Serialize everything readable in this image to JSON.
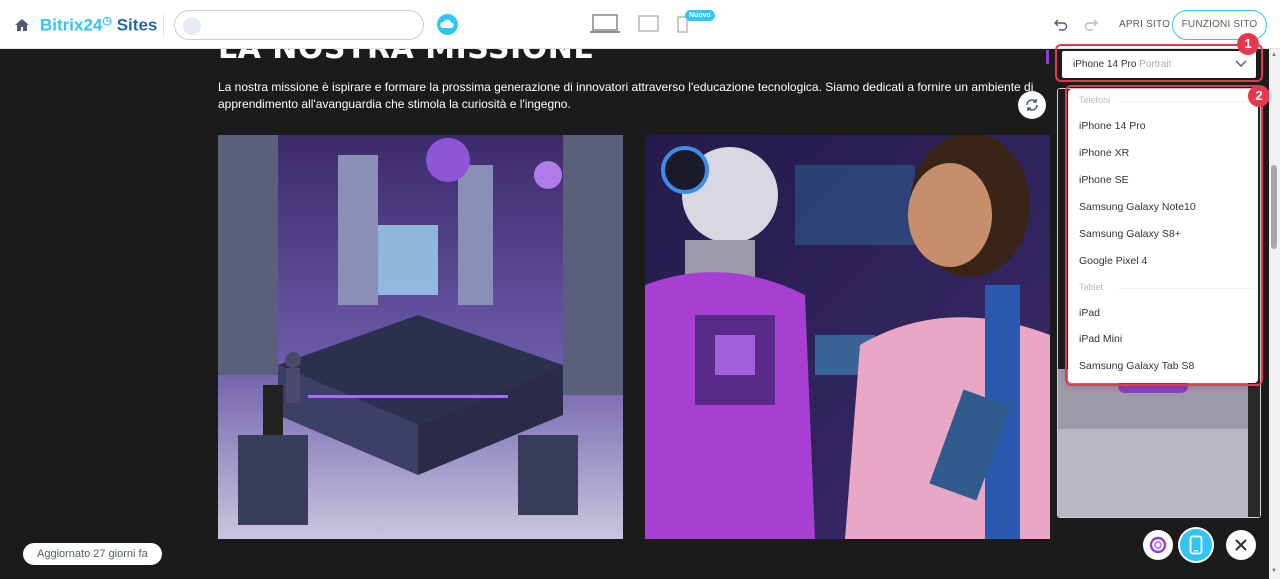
{
  "header": {
    "logo_b24": "Bitrix24",
    "logo_sites": "Sites",
    "new_badge": "Nuovo",
    "open_site": "APRI SITO",
    "site_features": "FUNZIONI SITO"
  },
  "page": {
    "title": "LA NOSTRA MISSIONE",
    "text": "La nostra missione è ispirare e formare la prossima generazione di innovatori attraverso l'educazione tecnologica. Siamo dedicati a fornire un ambiente di apprendimento all'avanguardia che stimola la curiosità e l'ingegno."
  },
  "device_select": {
    "selected_device": "iPhone 14 Pro",
    "orientation": "Portrait",
    "groups": [
      {
        "label": "Telefoni",
        "items": [
          "iPhone 14 Pro",
          "iPhone XR",
          "iPhone SE",
          "Samsung Galaxy Note10",
          "Samsung Galaxy S8+",
          "Google Pixel 4"
        ]
      },
      {
        "label": "Tablet",
        "items": [
          "iPad",
          "iPad Mini",
          "Samsung Galaxy Tab S8"
        ]
      }
    ]
  },
  "annotations": {
    "marker1": "1",
    "marker2": "2"
  },
  "footer": {
    "updated": "Aggiornato 27 giorni fa"
  },
  "colors": {
    "accent": "#2fc6f6",
    "highlight": "#e8384f",
    "brand_dark": "#2067b0",
    "background": "#1b1b1b"
  },
  "icons": [
    "home-icon",
    "cloud-icon",
    "desktop-icon",
    "tablet-icon",
    "phone-icon",
    "undo-icon",
    "redo-icon",
    "refresh-icon",
    "chevron-down-icon",
    "swirl-icon",
    "close-icon"
  ]
}
